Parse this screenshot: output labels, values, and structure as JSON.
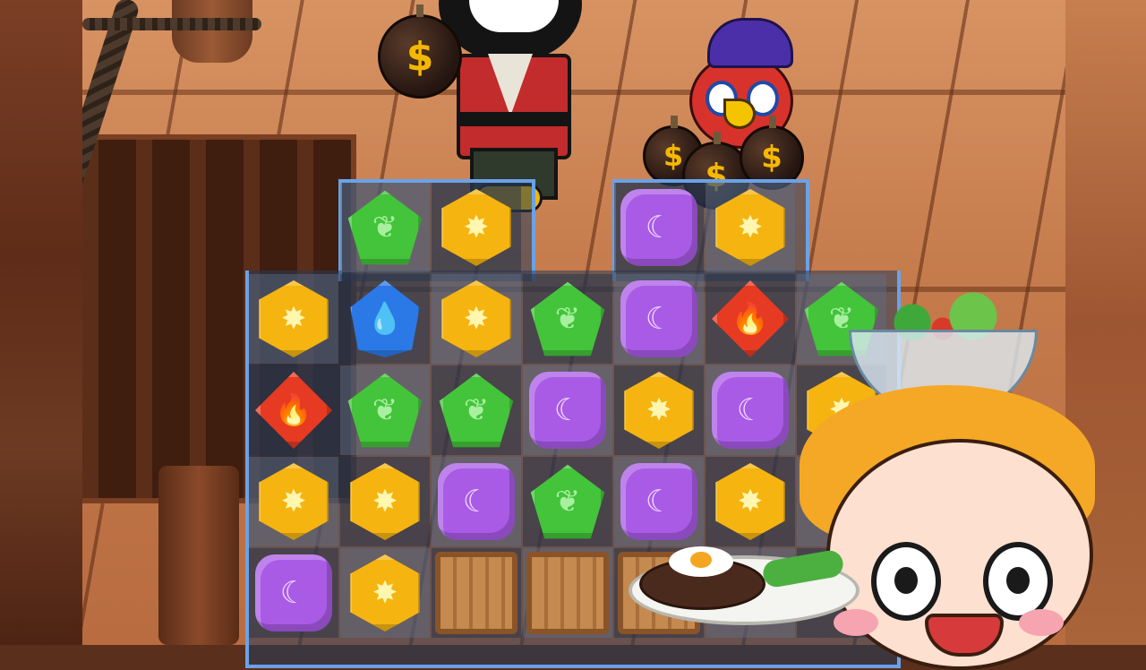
{
  "game": {
    "board": {
      "rows": [
        [
          "",
          "leaf",
          "sun",
          "",
          "moon",
          "sun",
          ""
        ],
        [
          "sun",
          "water",
          "sun",
          "leaf",
          "moon",
          "fire",
          "leaf"
        ],
        [
          "fire",
          "leaf",
          "leaf",
          "moon",
          "sun",
          "moon",
          "sun"
        ],
        [
          "sun",
          "sun",
          "moon",
          "leaf",
          "moon",
          "sun",
          ""
        ],
        [
          "moon",
          "sun",
          "crate",
          "crate",
          "crate",
          "",
          ""
        ]
      ]
    },
    "bomb_symbol": "$",
    "gem_icons": {
      "sun": "✸",
      "leaf": "❦",
      "moon": "☾",
      "water": "💧",
      "fire": "🔥"
    },
    "colors": {
      "board_outline": "#6aa2e8",
      "sun": "#f5b410",
      "leaf": "#43c43a",
      "moon": "#a95be6",
      "water": "#2b79e6",
      "fire": "#e73a22"
    }
  }
}
